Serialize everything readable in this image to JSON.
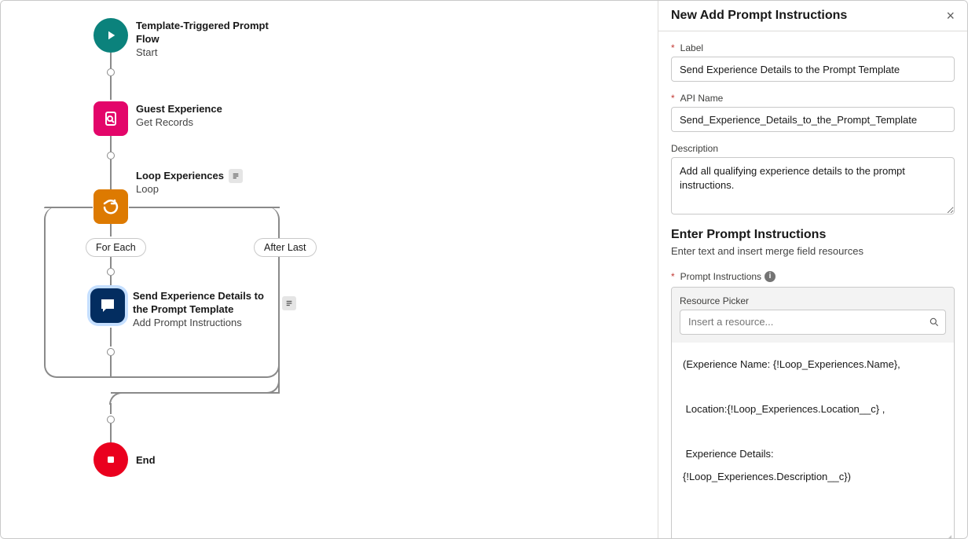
{
  "panel": {
    "title": "New Add Prompt Instructions",
    "label_field": {
      "label": "Label",
      "value": "Send Experience Details to the Prompt Template"
    },
    "api_field": {
      "label": "API Name",
      "value": "Send_Experience_Details_to_the_Prompt_Template"
    },
    "desc_field": {
      "label": "Description",
      "value": "Add all qualifying experience details to the prompt instructions."
    },
    "section_title": "Enter Prompt Instructions",
    "section_sub": "Enter text and insert merge field resources",
    "prompt_label": "Prompt Instructions",
    "resource_picker_label": "Resource Picker",
    "resource_placeholder": "Insert a resource...",
    "prompt_body": "(Experience Name: {!Loop_Experiences.Name},\n\n Location:{!Loop_Experiences.Location__c} ,\n\n Experience Details: {!Loop_Experiences.Description__c})"
  },
  "flow": {
    "start": {
      "title": "Template-Triggered Prompt Flow",
      "sub": "Start"
    },
    "record": {
      "title": "Guest Experience",
      "sub": "Get Records"
    },
    "loop": {
      "title": "Loop Experiences",
      "sub": "Loop"
    },
    "branch_foreach": "For Each",
    "branch_afterlast": "After Last",
    "prompt_node": {
      "title": "Send Experience Details to the Prompt Template",
      "sub": "Add Prompt Instructions"
    },
    "end": {
      "title": "End"
    }
  }
}
